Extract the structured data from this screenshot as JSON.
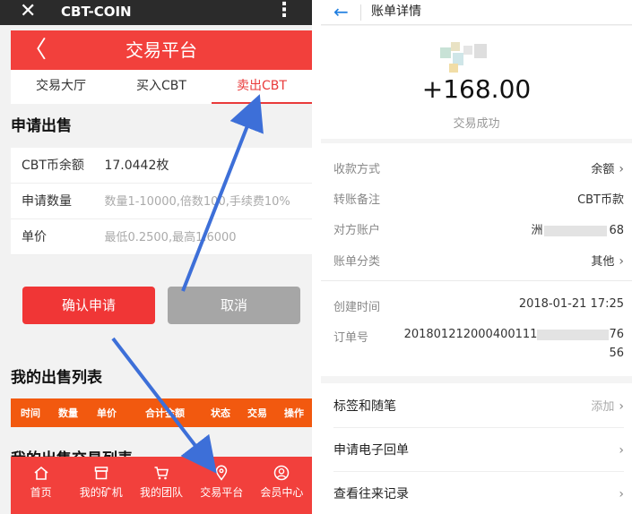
{
  "left": {
    "wechat": {
      "close": "✕",
      "title": "CBT-COIN",
      "more": "⋮"
    },
    "topbar": {
      "back": "〈",
      "title": "交易平台"
    },
    "tabs": [
      {
        "label": "交易大厅"
      },
      {
        "label": "买入CBT"
      },
      {
        "label": "卖出CBT"
      }
    ],
    "apply_title": "申请出售",
    "form": {
      "balance_label": "CBT币余额",
      "balance_value": "17.0442枚",
      "qty_label": "申请数量",
      "qty_placeholder": "数量1-10000,倍数100,手续费10%",
      "price_label": "单价",
      "price_placeholder": "最低0.2500,最高1.6000"
    },
    "confirm_label": "确认申请",
    "cancel_label": "取消",
    "list_title": "我的出售列表",
    "list_columns": [
      "时间",
      "数量",
      "单价",
      "合计金额",
      "状态",
      "交易",
      "操作"
    ],
    "trade_title": "我的出售交易列表",
    "nav": [
      {
        "label": "首页",
        "icon": "home-icon"
      },
      {
        "label": "我的矿机",
        "icon": "store-icon"
      },
      {
        "label": "我的团队",
        "icon": "cart-icon"
      },
      {
        "label": "交易平台",
        "icon": "location-icon"
      },
      {
        "label": "会员中心",
        "icon": "user-icon"
      }
    ],
    "colors": {
      "primary": "#f2403c",
      "header_orange": "#f2590f"
    }
  },
  "right": {
    "header": {
      "back": "←",
      "title": "账单详情"
    },
    "amount": "+168.00",
    "status": "交易成功",
    "details": {
      "method_label": "收款方式",
      "method_value": "余额",
      "memo_label": "转账备注",
      "memo_value": "CBT币款",
      "account_label": "对方账户",
      "account_prefix": "洲",
      "account_suffix": "68",
      "category_label": "账单分类",
      "category_value": "其他",
      "created_label": "创建时间",
      "created_value": "2018-01-21 17:25",
      "order_label": "订单号",
      "order_line1": "201801212000400111",
      "order_line1_tail": "76",
      "order_line2": "56"
    },
    "actions": {
      "tag_label": "标签和随笔",
      "tag_action": "添加",
      "receipt_label": "申请电子回单",
      "history_label": "查看往来记录"
    },
    "colors": {
      "accent": "#1f7ee0"
    }
  }
}
